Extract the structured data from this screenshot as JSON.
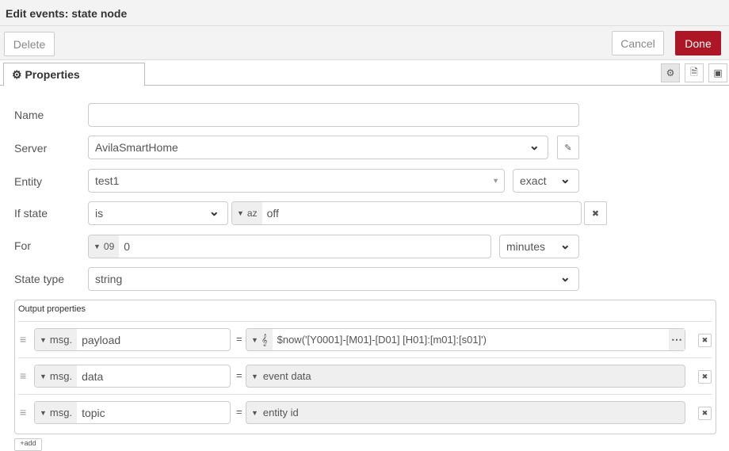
{
  "title": "Edit events: state node",
  "toolbar": {
    "delete": "Delete",
    "cancel": "Cancel",
    "done": "Done"
  },
  "tab": {
    "label": "Properties"
  },
  "form": {
    "name": {
      "label": "Name",
      "value": ""
    },
    "server": {
      "label": "Server",
      "value": "AvilaSmartHome"
    },
    "entity": {
      "label": "Entity",
      "value": "test1",
      "match": "exact"
    },
    "if_state": {
      "label": "If state",
      "operator": "is",
      "type_icon": "az",
      "value": "off"
    },
    "for": {
      "label": "For",
      "type_icon": "09",
      "value": "0",
      "unit": "minutes"
    },
    "state_type": {
      "label": "State type",
      "value": "string"
    }
  },
  "output": {
    "label": "Output properties",
    "rows": [
      {
        "prefix": "msg.",
        "property": "payload",
        "eq": "=",
        "value": "$now('[Y0001]-[M01]-[D01] [H01]:[m01]:[s01]')",
        "type": "jsonata"
      },
      {
        "prefix": "msg.",
        "property": "data",
        "eq": "=",
        "value": "event data",
        "type": "readonly"
      },
      {
        "prefix": "msg.",
        "property": "topic",
        "eq": "=",
        "value": "entity id",
        "type": "readonly"
      }
    ],
    "add": "add"
  }
}
